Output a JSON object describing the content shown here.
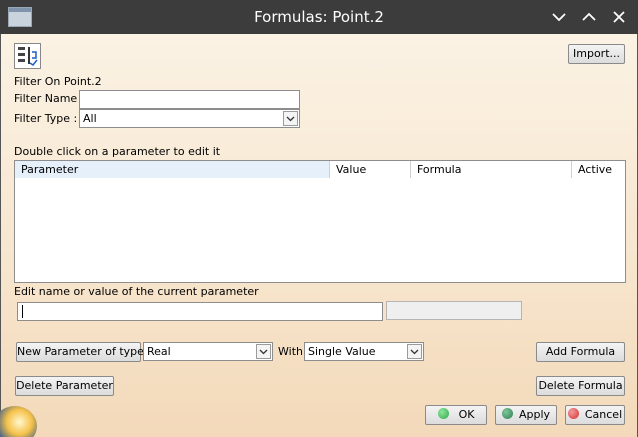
{
  "window": {
    "title": "Formulas: Point.2",
    "controls": [
      "minimize",
      "maximize",
      "close"
    ]
  },
  "toolbar": {
    "import_label": "Import..."
  },
  "filter": {
    "on_label": "Filter On Point.2",
    "name_label": "Filter Name :",
    "name_value": "",
    "type_label": "Filter Type :",
    "type_value": "All"
  },
  "parameters": {
    "hint": "Double click on a parameter to edit it",
    "columns": [
      "Parameter",
      "Value",
      "Formula",
      "Active"
    ],
    "rows": []
  },
  "edit": {
    "label": "Edit name or value of the current parameter",
    "name_value": "",
    "value_value": ""
  },
  "new_param": {
    "button_label": "New Parameter of type",
    "type_value": "Real",
    "with_label": "With",
    "with_value": "Single Value"
  },
  "actions": {
    "add_formula": "Add Formula",
    "delete_parameter": "Delete Parameter",
    "delete_formula": "Delete Formula",
    "ok": "OK",
    "apply": "Apply",
    "cancel": "Cancel"
  },
  "colors": {
    "titlebar": "#3c3c3c",
    "dialog_top": "#fbf2e4",
    "dialog_bottom": "#f3d9b9",
    "ok_icon": "#2fa84a",
    "apply_icon": "#2e7d4f",
    "cancel_icon": "#d93030",
    "header_highlight": "#e6f0fb"
  }
}
